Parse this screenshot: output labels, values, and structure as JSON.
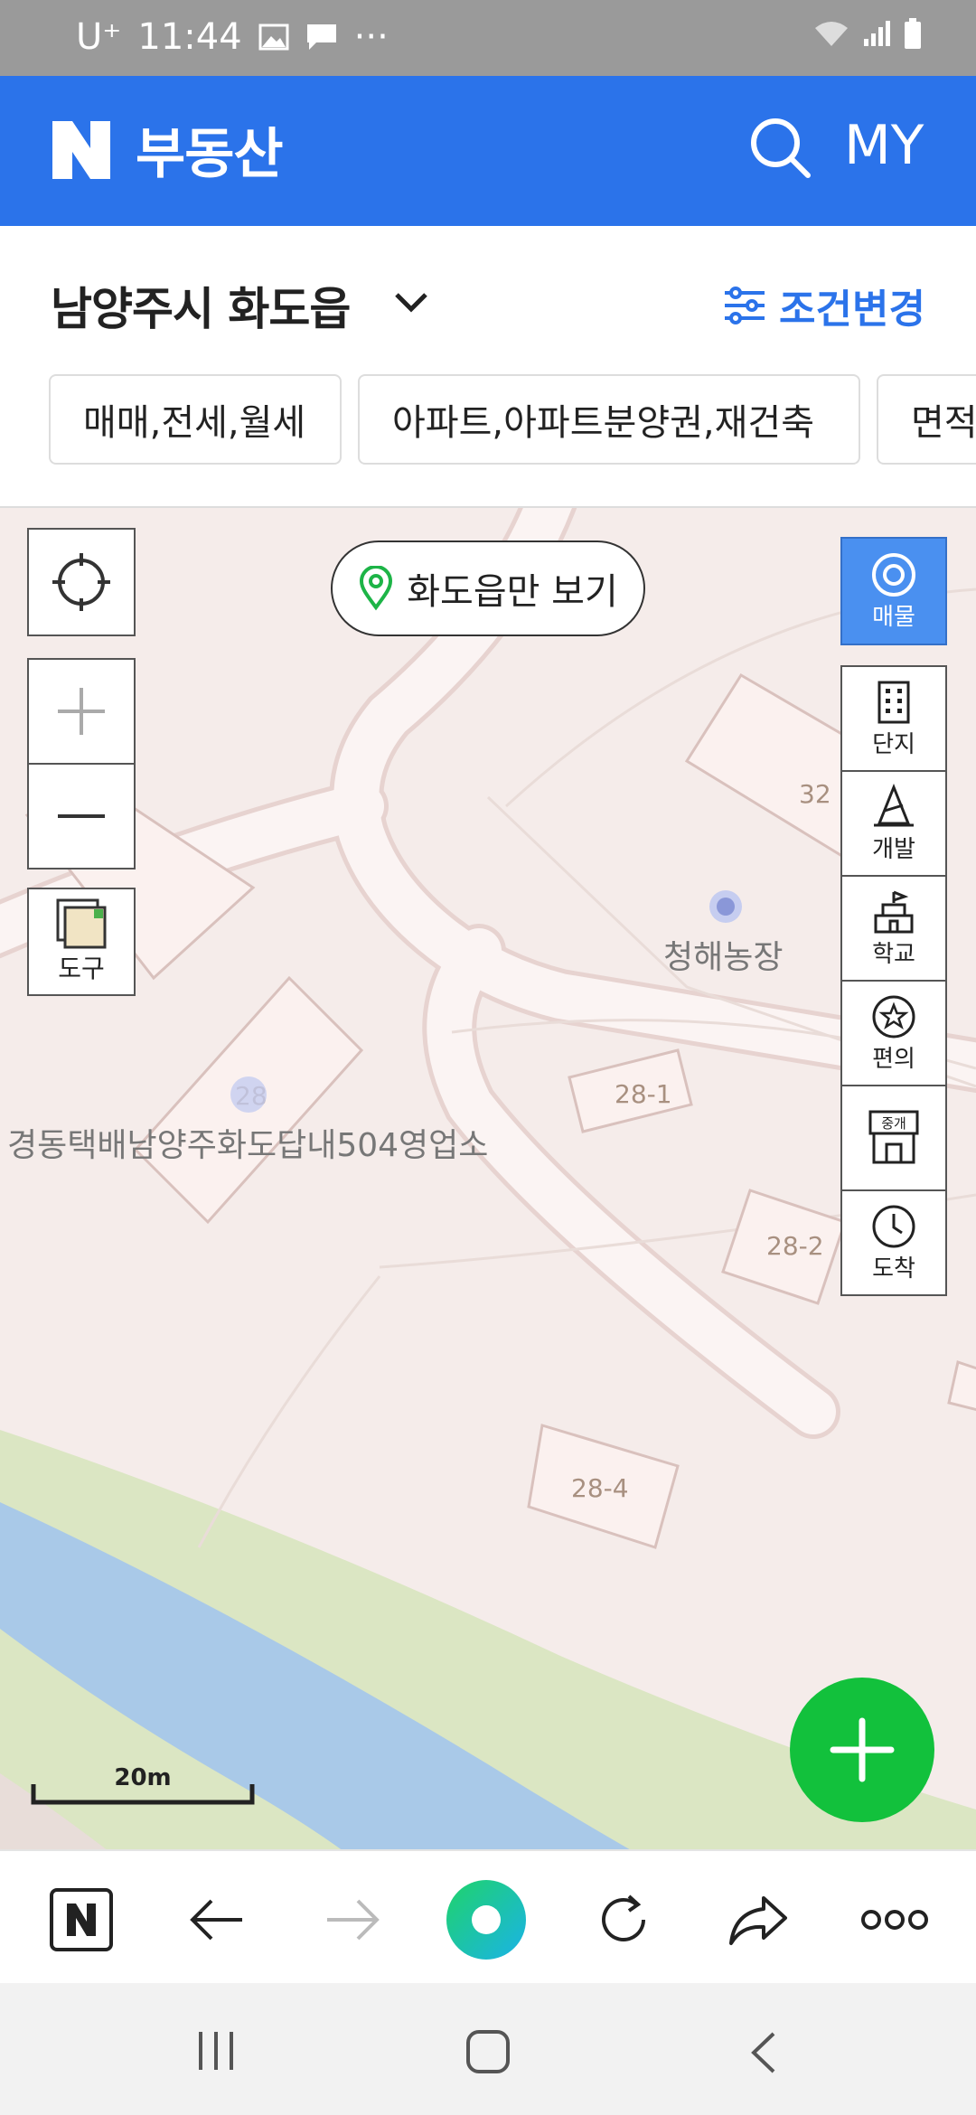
{
  "status_bar": {
    "carrier": "U⁺",
    "time": "11:44",
    "more": "···"
  },
  "header": {
    "brand_letter": "N",
    "title": "부동산",
    "my_label": "MY",
    "brand_color": "#2b73ea"
  },
  "location": {
    "name": "남양주시 화도읍",
    "condition_label": "조건변경"
  },
  "filters": [
    {
      "label": "매매,전세,월세"
    },
    {
      "label": "아파트,아파트분양권,재건축"
    },
    {
      "label": "면적"
    }
  ],
  "map": {
    "area_only_label": "화도읍만 보기",
    "tools_label": "도구",
    "side_buttons": [
      {
        "label": "매물",
        "icon": "listing-target-icon",
        "active": true
      },
      {
        "label": "단지",
        "icon": "building-icon"
      },
      {
        "label": "개발",
        "icon": "cone-icon"
      },
      {
        "label": "학교",
        "icon": "school-icon"
      },
      {
        "label": "편의",
        "icon": "star-icon"
      },
      {
        "label": "중개",
        "icon": "agency-icon"
      },
      {
        "label": "도착",
        "icon": "clock-icon"
      }
    ],
    "lot_labels": [
      "32",
      "28-1",
      "28-2",
      "28-4",
      "28"
    ],
    "poi_farm": "청해농장",
    "poi_delivery": "경동택배남양주화도답내504영업소",
    "scale_label": "20m",
    "active_color": "#4a90f0",
    "fab_color": "#12c13c"
  },
  "toolbar": {
    "brand_letter": "N"
  }
}
